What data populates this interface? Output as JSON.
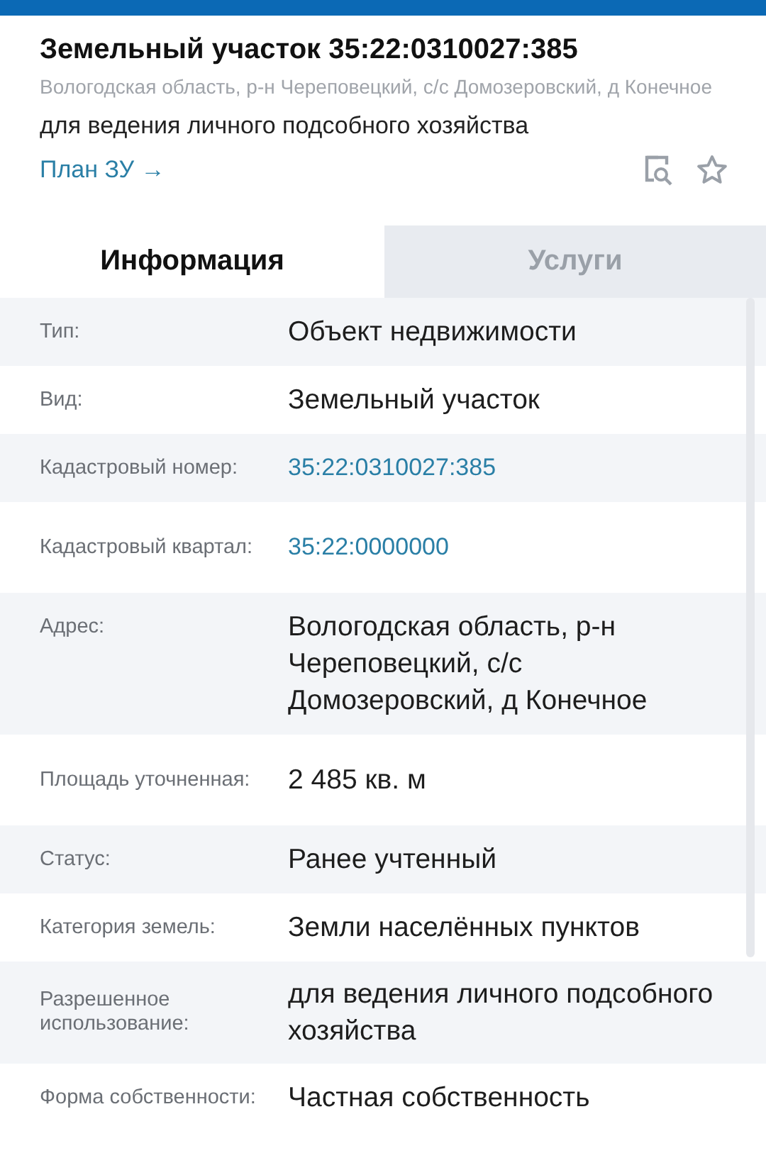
{
  "header": {
    "title": "Земельный участок 35:22:0310027:385",
    "address": "Вологодская область, р-н Череповецкий, с/с Домозеровский, д Конечное",
    "purpose": "для ведения личного подсобного хозяйства",
    "plan_link": "План ЗУ →"
  },
  "tabs": [
    {
      "label": "Информация",
      "selected": true
    },
    {
      "label": "Услуги",
      "selected": false
    }
  ],
  "rows": [
    {
      "label": "Тип:",
      "value": "Объект недвижимости",
      "kind": "text"
    },
    {
      "label": "Вид:",
      "value": "Земельный участок",
      "kind": "text"
    },
    {
      "label": "Кадастровый номер:",
      "value": "35:22:0310027:385",
      "kind": "link"
    },
    {
      "label": "Кадастровый квартал:",
      "value": "35:22:0000000",
      "kind": "link"
    },
    {
      "label": "Адрес:",
      "value": "Вологодская область, р-н Череповецкий, с/с Домозеровский, д Конечное",
      "kind": "text"
    },
    {
      "label": "Площадь уточненная:",
      "value": "2 485 кв. м",
      "kind": "text"
    },
    {
      "label": "Статус:",
      "value": "Ранее учтенный",
      "kind": "text"
    },
    {
      "label": "Категория земель:",
      "value": "Земли населённых пунктов",
      "kind": "text"
    },
    {
      "label": "Разрешенное использование:",
      "value": "для ведения личного подсобного хозяйства",
      "kind": "text"
    },
    {
      "label": "Форма собственности:",
      "value": "Частная собственность",
      "kind": "text"
    }
  ]
}
